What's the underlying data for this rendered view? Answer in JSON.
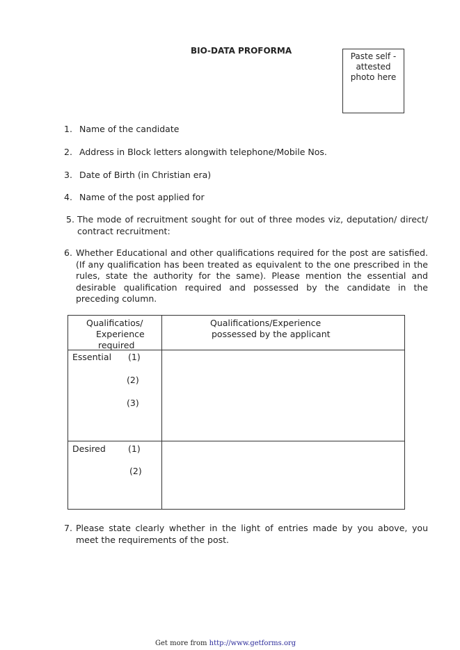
{
  "document": {
    "title": "BIO-DATA PROFORMA",
    "photo_box": [
      "Paste   self -",
      "attested",
      "photo here"
    ],
    "items": [
      {
        "num": "1.",
        "text": "Name of the candidate"
      },
      {
        "num": "2.",
        "text": "Address in Block letters alongwith telephone/Mobile Nos."
      },
      {
        "num": "3.",
        "text": "Date of Birth  (in Christian era)"
      },
      {
        "num": "4.",
        "text": "Name of the post applied for"
      },
      {
        "num": "5.",
        "text": "The mode of recruitment sought for out of three modes viz, deputation/ direct/ contract recruitment:"
      },
      {
        "num": "6.",
        "text": "Whether Educational and other qualifications required for the post are satisfied. (If any qualification has been treated as equivalent to the one prescribed in the rules, state the authority for the same). Please mention the essential and desirable qualification required and possessed by the candidate in the preceding column."
      },
      {
        "num": "7.",
        "text": "Please state clearly whether in the light of entries made by you above, you meet the requirements of the post."
      }
    ],
    "table": {
      "headers": [
        "Qualificatios/",
        "Experience",
        "required",
        "Qualifications/Experience",
        "possessed by the applicant"
      ],
      "essential": {
        "label": "Essential",
        "entries": [
          "(1)",
          "(2)",
          "(3)"
        ]
      },
      "desired": {
        "label": "Desired",
        "entries": [
          "(1)",
          "(2)"
        ]
      }
    }
  },
  "footer": {
    "prefix": "Get more from ",
    "link": "http://www.getforms.org"
  }
}
